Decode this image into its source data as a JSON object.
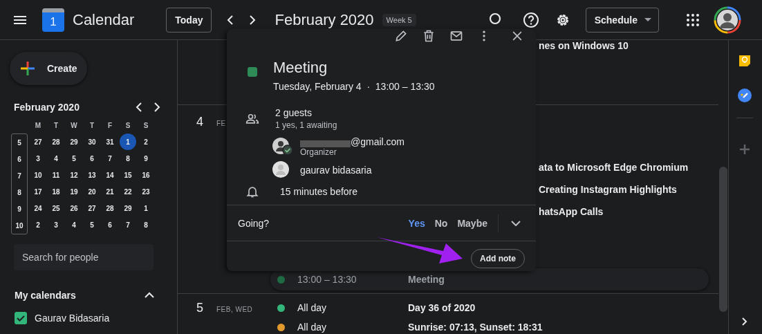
{
  "header": {
    "app_name": "Calendar",
    "logo_text": "1",
    "today_button": "Today",
    "title": "February 2020",
    "week_badge": "Week 5",
    "view_button": "Schedule"
  },
  "sidebar": {
    "create_button": "Create",
    "mini_calendar": {
      "title": "February 2020",
      "weekdays": [
        "M",
        "T",
        "W",
        "T",
        "F",
        "S",
        "S"
      ],
      "weeks": [
        {
          "number": "5",
          "days": [
            {
              "label": "27",
              "selected": false
            },
            {
              "label": "28",
              "selected": false
            },
            {
              "label": "29",
              "selected": false
            },
            {
              "label": "30",
              "selected": false
            },
            {
              "label": "31",
              "selected": false
            },
            {
              "label": "1",
              "selected": true
            },
            {
              "label": "2",
              "selected": false
            }
          ]
        },
        {
          "number": "6",
          "days": [
            {
              "label": "3",
              "selected": false
            },
            {
              "label": "4",
              "selected": false
            },
            {
              "label": "5",
              "selected": false
            },
            {
              "label": "6",
              "selected": false
            },
            {
              "label": "7",
              "selected": false
            },
            {
              "label": "8",
              "selected": false
            },
            {
              "label": "9",
              "selected": false
            }
          ]
        },
        {
          "number": "7",
          "days": [
            {
              "label": "10",
              "selected": false
            },
            {
              "label": "11",
              "selected": false
            },
            {
              "label": "12",
              "selected": false
            },
            {
              "label": "13",
              "selected": false
            },
            {
              "label": "14",
              "selected": false
            },
            {
              "label": "15",
              "selected": false
            },
            {
              "label": "16",
              "selected": false
            }
          ]
        },
        {
          "number": "8",
          "days": [
            {
              "label": "17",
              "selected": false
            },
            {
              "label": "18",
              "selected": false
            },
            {
              "label": "19",
              "selected": false
            },
            {
              "label": "20",
              "selected": false
            },
            {
              "label": "21",
              "selected": false
            },
            {
              "label": "22",
              "selected": false
            },
            {
              "label": "23",
              "selected": false
            }
          ]
        },
        {
          "number": "9",
          "days": [
            {
              "label": "24",
              "selected": false
            },
            {
              "label": "25",
              "selected": false
            },
            {
              "label": "26",
              "selected": false
            },
            {
              "label": "27",
              "selected": false
            },
            {
              "label": "28",
              "selected": false
            },
            {
              "label": "29",
              "selected": false
            },
            {
              "label": "1",
              "selected": false
            }
          ]
        },
        {
          "number": "10",
          "days": [
            {
              "label": "2",
              "selected": false
            },
            {
              "label": "3",
              "selected": false
            },
            {
              "label": "4",
              "selected": false
            },
            {
              "label": "5",
              "selected": false
            },
            {
              "label": "6",
              "selected": false
            },
            {
              "label": "7",
              "selected": false
            },
            {
              "label": "8",
              "selected": false
            }
          ]
        }
      ]
    },
    "search": {
      "placeholder": "Search for people"
    },
    "my_calendars": {
      "title": "My calendars",
      "expanded": true,
      "items": [
        {
          "name": "Gaurav Bidasaria",
          "checked": true,
          "color": "#33b679"
        }
      ]
    }
  },
  "schedule": {
    "days": [
      {
        "events": [
          {
            "kind": "partial",
            "title": "nes on Windows 10"
          }
        ]
      },
      {
        "day": "4",
        "label": "FE",
        "events": [
          {
            "kind": "partial",
            "title": "ata to Microsoft Edge Chromium"
          },
          {
            "kind": "partial",
            "title": "Creating Instagram Highlights"
          },
          {
            "kind": "partial",
            "title": "hatsApp Calls"
          },
          {
            "kind": "full",
            "time": "13:00 – 13:30",
            "title": "Meeting",
            "color": "#1e6b43",
            "selected": true
          }
        ]
      },
      {
        "day": "5",
        "label": "FEB, WED",
        "events": [
          {
            "kind": "full",
            "time": "All day",
            "title": "Day 36 of 2020",
            "color": "#33b679",
            "selected": false
          },
          {
            "kind": "full",
            "time": "All day",
            "title": "Sunrise: 07:13, Sunset: 18:31",
            "color": "#e39a2c",
            "selected": false
          }
        ]
      }
    ]
  },
  "event_popup": {
    "title": "Meeting",
    "color": "#2e8b57",
    "when": "Tuesday, February 4  ·  13:00 – 13:30",
    "guests_title": "2 guests",
    "guests_summary": "1 yes, 1 awaiting",
    "guests": [
      {
        "kind": "photo",
        "redacted": true,
        "name": "@gmail.com",
        "role": "Organizer",
        "accepted": true
      },
      {
        "kind": "default",
        "redacted": false,
        "name": "gaurav bidasaria",
        "accepted": false
      }
    ],
    "reminder": "15 minutes before",
    "going_label": "Going?",
    "rsvp": [
      {
        "label": "Yes",
        "selected": true
      },
      {
        "label": "No",
        "selected": false
      },
      {
        "label": "Maybe",
        "selected": false
      }
    ],
    "add_note": "Add note"
  }
}
